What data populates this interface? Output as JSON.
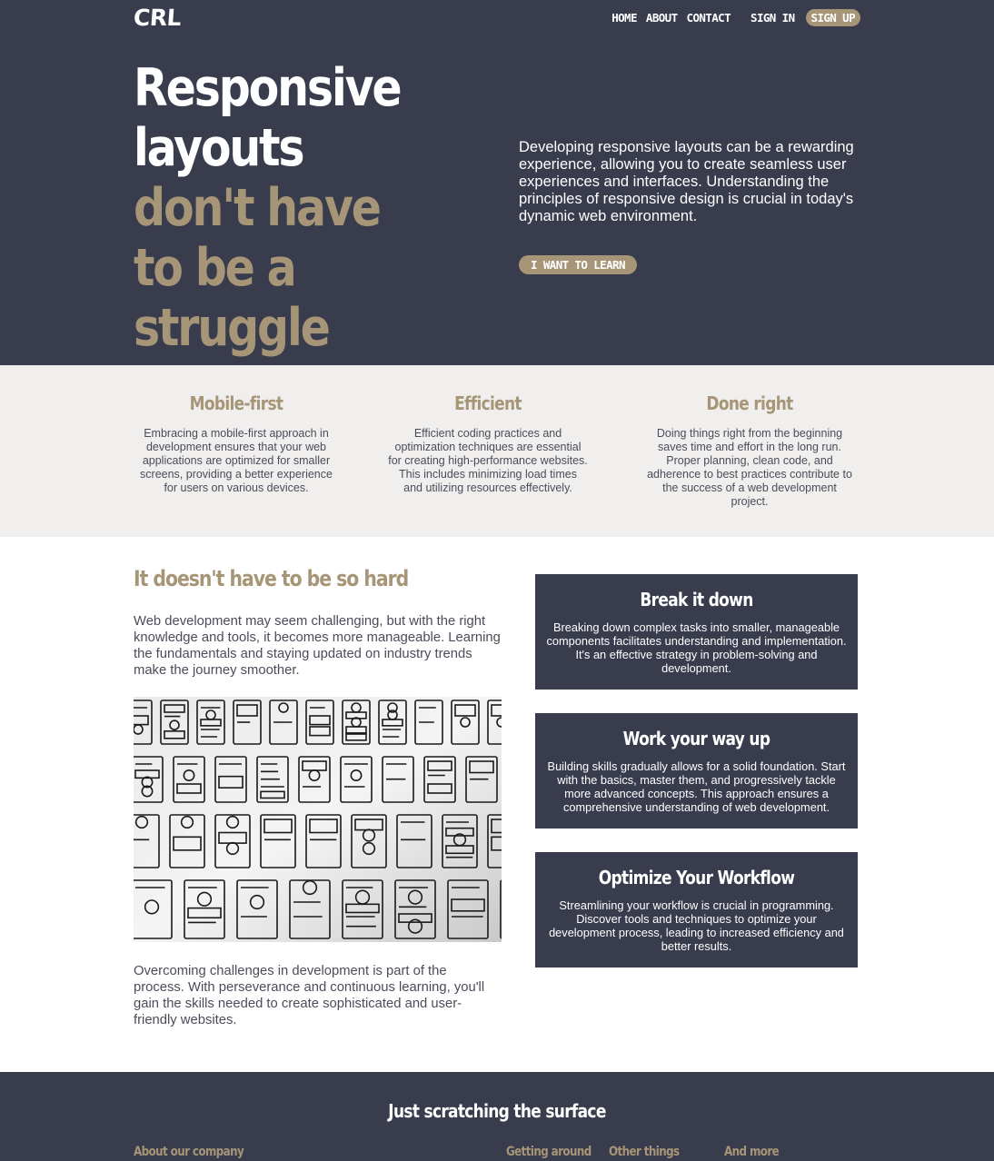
{
  "nav": {
    "logo": "CRL",
    "links": [
      "HOME",
      "ABOUT",
      "CONTACT"
    ],
    "sign_in": "SIGN IN",
    "sign_up": "SIGN UP"
  },
  "hero": {
    "title_white": "Responsive layouts",
    "title_accent": "don't have to be a struggle",
    "description": "Developing responsive layouts can be a rewarding experience, allowing you to create seamless user experiences and interfaces. Understanding the principles of responsive design is crucial in today's dynamic web environment.",
    "button": "I WANT TO LEARN"
  },
  "features": [
    {
      "title": "Mobile-first",
      "text": "Embracing a mobile-first approach in development ensures that your web applications are optimized for smaller screens, providing a better experience for users on various devices."
    },
    {
      "title": "Efficient",
      "text": "Efficient coding practices and optimization techniques are essential for creating high-performance websites. This includes minimizing load times and utilizing resources effectively."
    },
    {
      "title": "Done right",
      "text": "Doing things right from the beginning saves time and effort in the long run. Proper planning, clean code, and adherence to best practices contribute to the success of a web development project."
    }
  ],
  "main": {
    "title": "It doesn't have to be so hard",
    "paragraph1": "Web development may seem challenging, but with the right knowledge and tools, it becomes more manageable. Learning the fundamentals and staying updated on industry trends make the journey smoother.",
    "paragraph2": "Overcoming challenges in development is part of the process. With perseverance and continuous learning, you'll gain the skills needed to create sophisticated and user-friendly websites.",
    "cards": [
      {
        "title": "Break it down",
        "text": "Breaking down complex tasks into smaller, manageable components facilitates understanding and implementation. It's an effective strategy in problem-solving and development."
      },
      {
        "title": "Work your way up",
        "text": "Building skills gradually allows for a solid foundation. Start with the basics, master them, and progressively tackle more advanced concepts. This approach ensures a comprehensive understanding of web development."
      },
      {
        "title": "Optimize Your Workflow",
        "text": "Streamlining your workflow is crucial in programming. Discover tools and techniques to optimize your development process, leading to increased efficiency and better results."
      }
    ]
  },
  "footer": {
    "title": "Just scratching the surface",
    "columns": [
      "About our company",
      "Getting around",
      "Other things",
      "And more"
    ]
  },
  "colors": {
    "dark": "#393c4d",
    "accent": "#a69677",
    "light": "#f0efee"
  }
}
